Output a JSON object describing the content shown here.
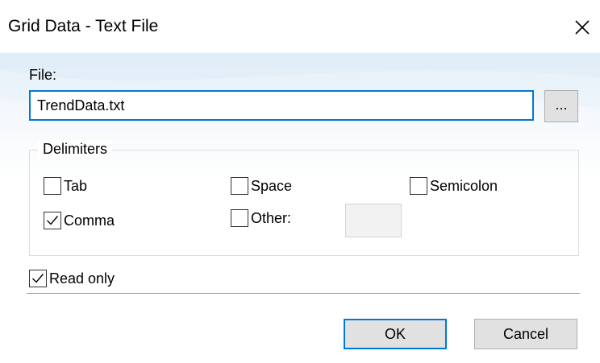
{
  "window": {
    "title": "Grid Data - Text File",
    "close_icon": "close-icon"
  },
  "file": {
    "label": "File:",
    "value": "TrendData.txt",
    "browse_label": "..."
  },
  "delimiters": {
    "group_label": "Delimiters",
    "options": [
      {
        "label": "Tab",
        "checked": false
      },
      {
        "label": "Space",
        "checked": false
      },
      {
        "label": "Semicolon",
        "checked": false
      },
      {
        "label": "Comma",
        "checked": true
      },
      {
        "label": "Other:",
        "checked": false
      }
    ],
    "other_value": ""
  },
  "read_only": {
    "label": "Read only",
    "checked": true
  },
  "buttons": {
    "ok": "OK",
    "cancel": "Cancel"
  },
  "colors": {
    "accent": "#0078d7",
    "button_bg": "#e1e1e1",
    "client_gradient_top": "#e3eef7"
  }
}
